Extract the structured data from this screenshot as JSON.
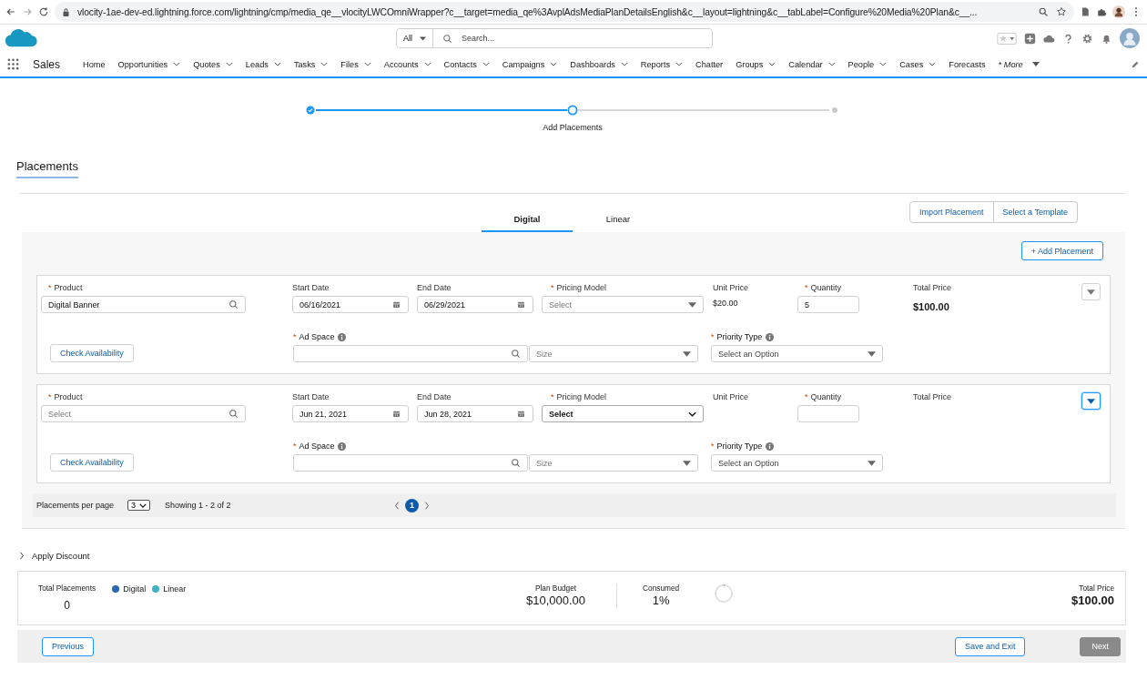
{
  "browser": {
    "url": "vlocity-1ae-dev-ed.lightning.force.com/lightning/cmp/media_qe__vlocityLWCOmniWrapper?c__target=media_qe%3AvplAdsMediaPlanDetailsEnglish&c__layout=lightning&c__tabLabel=Configure%20Media%20Plan&c__..."
  },
  "header": {
    "search_scope": "All",
    "search_placeholder": "Search..."
  },
  "nav": {
    "app_name": "Sales",
    "items": [
      {
        "label": "Home",
        "kind": "link"
      },
      {
        "label": "Opportunities",
        "kind": "menu"
      },
      {
        "label": "Quotes",
        "kind": "menu"
      },
      {
        "label": "Leads",
        "kind": "menu"
      },
      {
        "label": "Tasks",
        "kind": "menu"
      },
      {
        "label": "Files",
        "kind": "menu"
      },
      {
        "label": "Accounts",
        "kind": "menu"
      },
      {
        "label": "Contacts",
        "kind": "menu"
      },
      {
        "label": "Campaigns",
        "kind": "menu"
      },
      {
        "label": "Dashboards",
        "kind": "menu"
      },
      {
        "label": "Reports",
        "kind": "menu"
      },
      {
        "label": "Chatter",
        "kind": "link"
      },
      {
        "label": "Groups",
        "kind": "menu"
      },
      {
        "label": "Calendar",
        "kind": "menu"
      },
      {
        "label": "People",
        "kind": "menu"
      },
      {
        "label": "Cases",
        "kind": "menu"
      },
      {
        "label": "Forecasts",
        "kind": "link"
      },
      {
        "label": "* More",
        "kind": "more"
      }
    ]
  },
  "progress": {
    "steps": [
      {
        "kind": "complete"
      },
      {
        "kind": "current",
        "label": "Add Placements"
      },
      {
        "kind": "pending"
      }
    ]
  },
  "section_title": "Placements",
  "tabs": [
    {
      "label": "Digital",
      "selected": true
    },
    {
      "label": "Linear",
      "selected": false
    }
  ],
  "actions": [
    "Import Placement",
    "Select a Template"
  ],
  "add_button": "+ Add Placement",
  "placements": [
    {
      "product": {
        "mark": "*",
        "label": "Product",
        "value": "Digital Banner"
      },
      "start_date": {
        "label": "Start Date",
        "value": "06/16/2021"
      },
      "end_date": {
        "label": "End Date",
        "value": "06/29/2021"
      },
      "pricing_model": {
        "mark": "*",
        "label": "Pricing Model",
        "kind": "combobox",
        "placeholder": "Select"
      },
      "unit_price": {
        "label": "Unit Price",
        "value": "$20.00"
      },
      "quantity": {
        "mark": "*",
        "label": "Quantity",
        "value": "5"
      },
      "total_price": {
        "label": "Total Price",
        "value": "$100.00"
      },
      "menu_focused": false,
      "availability_button": "Check Availability",
      "ad_space": {
        "mark": "*",
        "label": "Ad Space"
      },
      "size": {
        "placeholder": "Size"
      },
      "priority_type": {
        "mark": "*",
        "label": "Priority Type",
        "placeholder": "Select an Option"
      }
    },
    {
      "product": {
        "mark": "*",
        "label": "Product",
        "placeholder": "Select"
      },
      "start_date": {
        "label": "Start Date",
        "value": "Jun 21, 2021"
      },
      "end_date": {
        "label": "End Date",
        "value": "Jun 28, 2021"
      },
      "pricing_model": {
        "mark": "*",
        "label": "Pricing Model",
        "kind": "native",
        "value": "Select"
      },
      "unit_price": {
        "label": "Unit Price"
      },
      "quantity": {
        "mark": "*",
        "label": "Quantity"
      },
      "total_price": {
        "label": "Total Price"
      },
      "menu_focused": true,
      "availability_button": "Check Availability",
      "ad_space": {
        "mark": "*",
        "label": "Ad Space"
      },
      "size": {
        "placeholder": "Size"
      },
      "priority_type": {
        "mark": "*",
        "label": "Priority Type",
        "placeholder": "Select an Option"
      }
    }
  ],
  "pagination": {
    "per_page_label": "Placements per page",
    "per_page": "3",
    "showing": "Showing 1 - 2 of 2",
    "pages": [
      {
        "label": "1",
        "selected": true
      }
    ]
  },
  "discount": {
    "label": "Apply Discount",
    "expanded": false
  },
  "summary": {
    "total_placements_label": "Total Placements",
    "total_placements": "0",
    "legend": [
      {
        "label": "Digital",
        "color": "#2a67b1"
      },
      {
        "label": "Linear",
        "color": "#3fb3c4"
      }
    ],
    "plan_budget_label": "Plan Budget",
    "plan_budget": "$10,000.00",
    "consumed_label": "Consumed",
    "consumed": "1%",
    "level": 0.01,
    "total_price_label": "Total Price",
    "total_price": "$100.00"
  },
  "footer": [
    {
      "label": "Previous",
      "kind": "back",
      "disabled": false
    },
    {
      "label": "Save and Exit",
      "kind": "save",
      "disabled": false
    },
    {
      "label": "Next",
      "kind": "next",
      "disabled": true
    }
  ]
}
